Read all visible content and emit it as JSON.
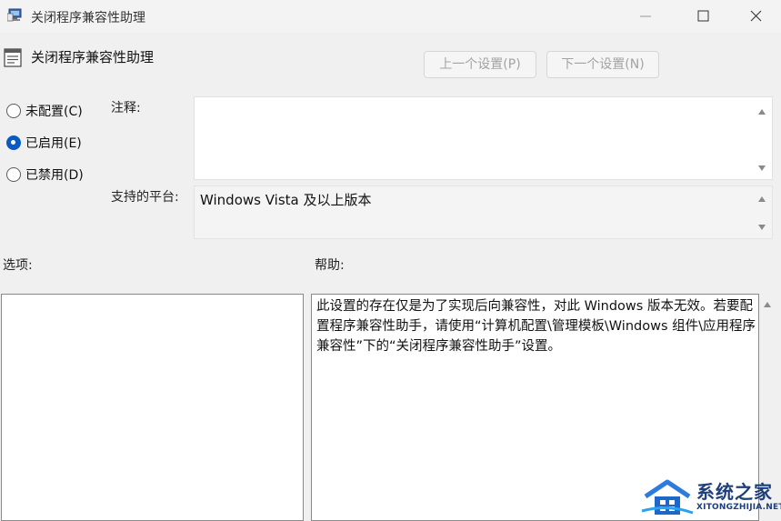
{
  "window": {
    "title": "关闭程序兼容性助理"
  },
  "header": {
    "title": "关闭程序兼容性助理",
    "prev_button": "上一个设置(P)",
    "next_button": "下一个设置(N)"
  },
  "state_options": [
    {
      "label": "未配置(C)",
      "selected": false
    },
    {
      "label": "已启用(E)",
      "selected": true
    },
    {
      "label": "已禁用(D)",
      "selected": false
    }
  ],
  "comment": {
    "label": "注释:",
    "value": ""
  },
  "platform": {
    "label": "支持的平台:",
    "value": "Windows Vista 及以上版本"
  },
  "options": {
    "label": "选项:"
  },
  "help": {
    "label": "帮助:",
    "text": "此设置的存在仅是为了实现后向兼容性，对此 Windows 版本无效。若要配置程序兼容性助手，请使用“计算机配置\\管理模板\\Windows 组件\\应用程序兼容性”下的“关闭程序兼容性助手”设置。"
  },
  "watermark": {
    "name": "系统之家",
    "url": "XITONGZHIJIA.NET"
  },
  "colors": {
    "accent": "#0a59c4",
    "window_bg": "#f0f0f0",
    "disabled_text": "#a3a3a3"
  }
}
